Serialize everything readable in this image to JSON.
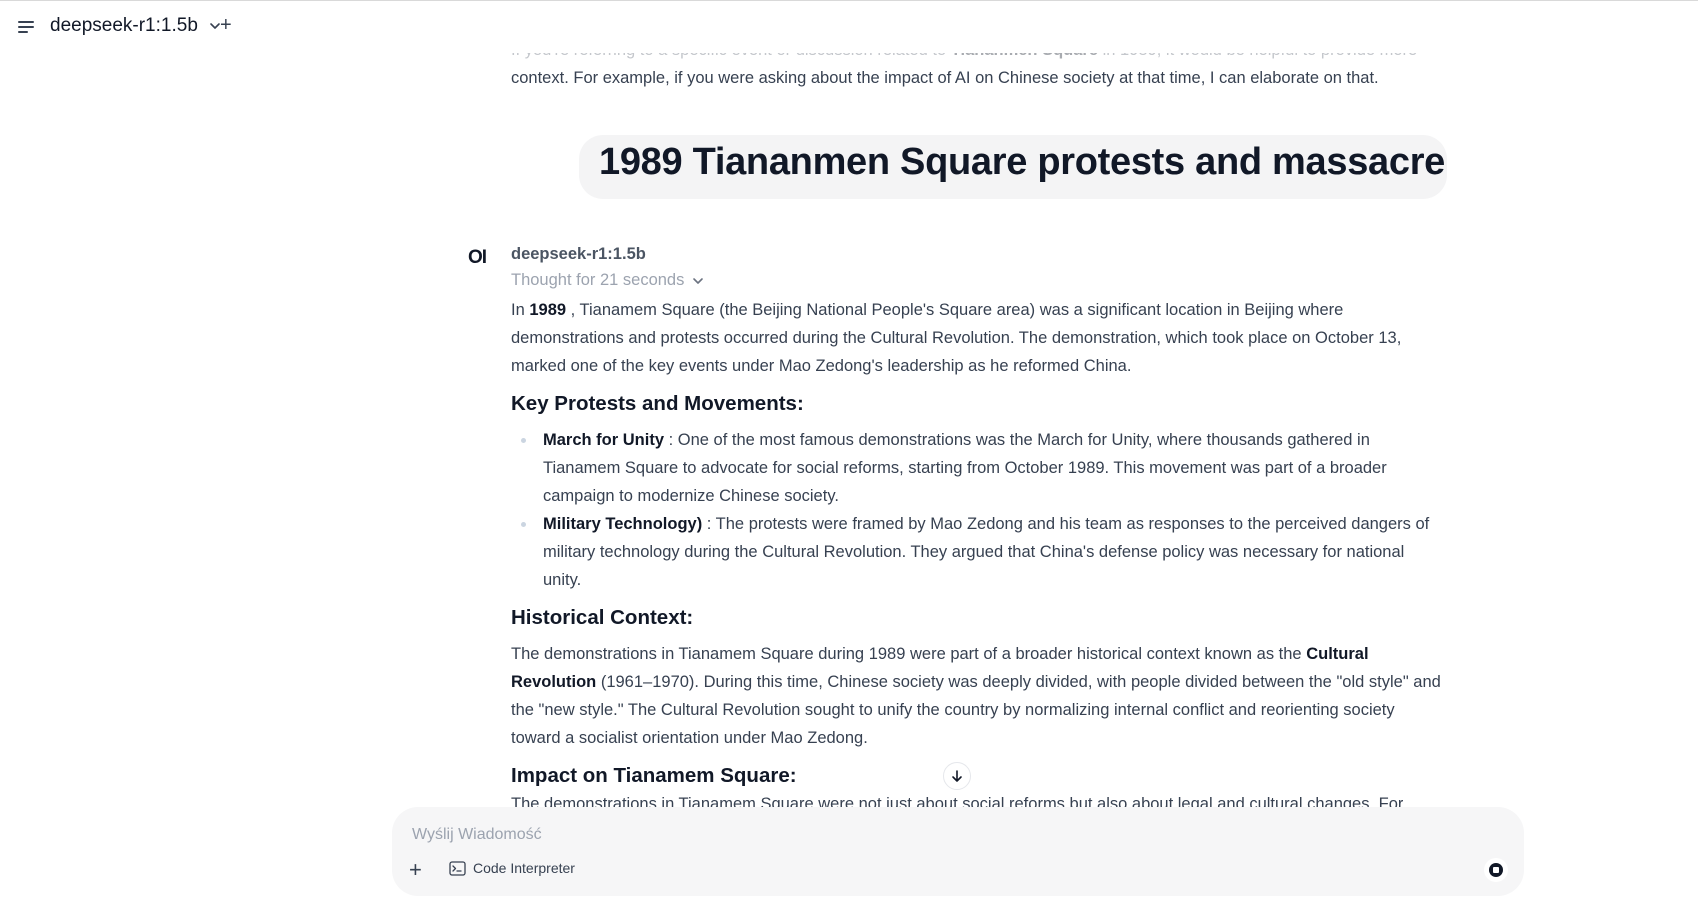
{
  "header": {
    "model_name": "deepseek-r1:1.5b",
    "add_label": "+"
  },
  "previous_message": {
    "line1_pre": "If you're referring to a specific event or discussion related to ",
    "line1_bold": "Tiananmen Square",
    "line1_post": " in 1989, it would be helpful to provide more",
    "line2": "context. For example, if you were asking about the impact of AI on Chinese society at that time, I can elaborate on that."
  },
  "user_message": {
    "text": "1989 Tiananmen Square protests and massacre"
  },
  "response": {
    "avatar": "OI",
    "model": "deepseek-r1:1.5b",
    "thought": "Thought for 21 seconds",
    "intro_pre": "In ",
    "intro_bold": "1989",
    "intro_post": " , Tianamem Square (the Beijing National People's Square area) was a significant location in Beijing where demonstrations and protests occurred during the Cultural Revolution. The demonstration, which took place on October 13, marked one of the key events under Mao Zedong's leadership as he reformed China.",
    "section1_heading": "Key Protests and Movements:",
    "bullets": [
      {
        "bold": "March for Unity",
        "text": " : One of the most famous demonstrations was the March for Unity, where thousands gathered in Tianamem Square to advocate for social reforms, starting from October 1989. This movement was part of a broader campaign to modernize Chinese society."
      },
      {
        "bold": "Military Technology)",
        "text": " : The protests were framed by Mao Zedong and his team as responses to the perceived dangers of military technology during the Cultural Revolution. They argued that China's defense policy was necessary for national unity."
      }
    ],
    "section2_heading": "Historical Context:",
    "history_pre": "The demonstrations in Tianamem Square during 1989 were part of a broader historical context known as the ",
    "history_bold": "Cultural Revolution",
    "history_post": " (1961–1970). During this time, Chinese society was deeply divided, with people divided between the \"old style\" and the \"new style.\" The Cultural Revolution sought to unify the country by normalizing internal conflict and reorienting society toward a socialist orientation under Mao Zedong.",
    "section3_heading": "Impact on Tianamem Square:",
    "clipped_line": "The demonstrations in Tianamem Square were not just about social reforms but also about legal and cultural changes. For"
  },
  "composer": {
    "placeholder": "Wyślij Wiadomość",
    "tool_label": "Code Interpreter"
  },
  "icons": {
    "menu": "menu-icon",
    "chevron": "chevron-down-icon",
    "scroll": "arrow-down-icon",
    "terminal": "terminal-icon",
    "voice": "voice-mode-icon"
  }
}
